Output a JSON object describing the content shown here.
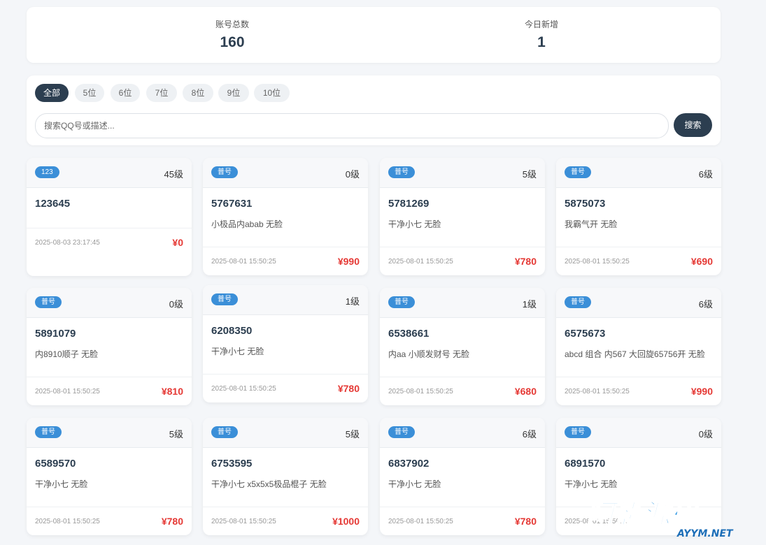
{
  "stats": {
    "total_label": "账号总数",
    "total_value": "160",
    "today_label": "今日新增",
    "today_value": "1"
  },
  "filters": {
    "chips": [
      "全部",
      "5位",
      "6位",
      "7位",
      "8位",
      "9位",
      "10位"
    ],
    "active_index": 0,
    "search_placeholder": "搜索QQ号或描述...",
    "search_button": "搜索"
  },
  "cards": [
    {
      "badge": "123",
      "level": "45级",
      "number": "123645",
      "desc": "",
      "date": "2025-08-03 23:17:45",
      "price": "¥0"
    },
    {
      "badge": "普号",
      "level": "0级",
      "number": "5767631",
      "desc": "小极品内abab 无脸",
      "date": "2025-08-01 15:50:25",
      "price": "¥990"
    },
    {
      "badge": "普号",
      "level": "5级",
      "number": "5781269",
      "desc": "干净小七 无脸",
      "date": "2025-08-01 15:50:25",
      "price": "¥780"
    },
    {
      "badge": "普号",
      "level": "6级",
      "number": "5875073",
      "desc": "我霸气开 无脸",
      "date": "2025-08-01 15:50:25",
      "price": "¥690"
    },
    {
      "badge": "普号",
      "level": "0级",
      "number": "5891079",
      "desc": "内8910顺子 无脸",
      "date": "2025-08-01 15:50:25",
      "price": "¥810"
    },
    {
      "badge": "普号",
      "level": "1级",
      "number": "6208350",
      "desc": "干净小七 无脸",
      "date": "2025-08-01 15:50:25",
      "price": "¥780"
    },
    {
      "badge": "普号",
      "level": "1级",
      "number": "6538661",
      "desc": "内aa 小顺发财号 无脸",
      "date": "2025-08-01 15:50:25",
      "price": "¥680"
    },
    {
      "badge": "普号",
      "level": "6级",
      "number": "6575673",
      "desc": "abcd 组合 内567 大回旋65756开 无脸",
      "date": "2025-08-01 15:50:25",
      "price": "¥990"
    },
    {
      "badge": "普号",
      "level": "5级",
      "number": "6589570",
      "desc": "干净小七 无脸",
      "date": "2025-08-01 15:50:25",
      "price": "¥780"
    },
    {
      "badge": "普号",
      "level": "5级",
      "number": "6753595",
      "desc": "干净小七 x5x5x5极品棍子 无脸",
      "date": "2025-08-01 15:50:25",
      "price": "¥1000"
    },
    {
      "badge": "普号",
      "level": "6级",
      "number": "6837902",
      "desc": "干净小七 无脸",
      "date": "2025-08-01 15:50:25",
      "price": "¥780"
    },
    {
      "badge": "普号",
      "level": "0级",
      "number": "6891570",
      "desc": "干净小七 无脸",
      "date": "2025-08-01 15:50:25",
      "price": ""
    }
  ],
  "watermark": {
    "text": "阿影源码",
    "domain": "AYYM.NET"
  },
  "colors": {
    "accent": "#2c3e50",
    "badge": "#3b8fd8",
    "price": "#e53935"
  }
}
